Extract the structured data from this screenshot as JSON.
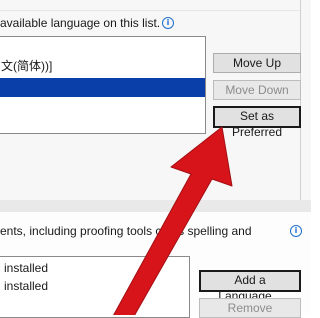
{
  "display_languages": {
    "description": "available language on this list.",
    "list_items": [
      {
        "label": "文(简体))]",
        "selected": false
      },
      {
        "label": "",
        "selected": true
      }
    ],
    "buttons": {
      "move_up": "Move Up",
      "move_down": "Move Down",
      "set_preferred": "Set as Preferred"
    }
  },
  "authoring_languages": {
    "description": "ents, including proofing tools   ch as spelling and",
    "list_items": [
      {
        "label": "installed"
      },
      {
        "label": "installed"
      }
    ],
    "buttons": {
      "add_language": "Add a Language...",
      "remove": "Remove"
    }
  },
  "colors": {
    "selection": "#0a3ea8",
    "arrow": "#d7141a",
    "info_icon": "#1e6ed0"
  },
  "icons": {
    "info": "info-icon",
    "annotation": "red-arrow"
  }
}
